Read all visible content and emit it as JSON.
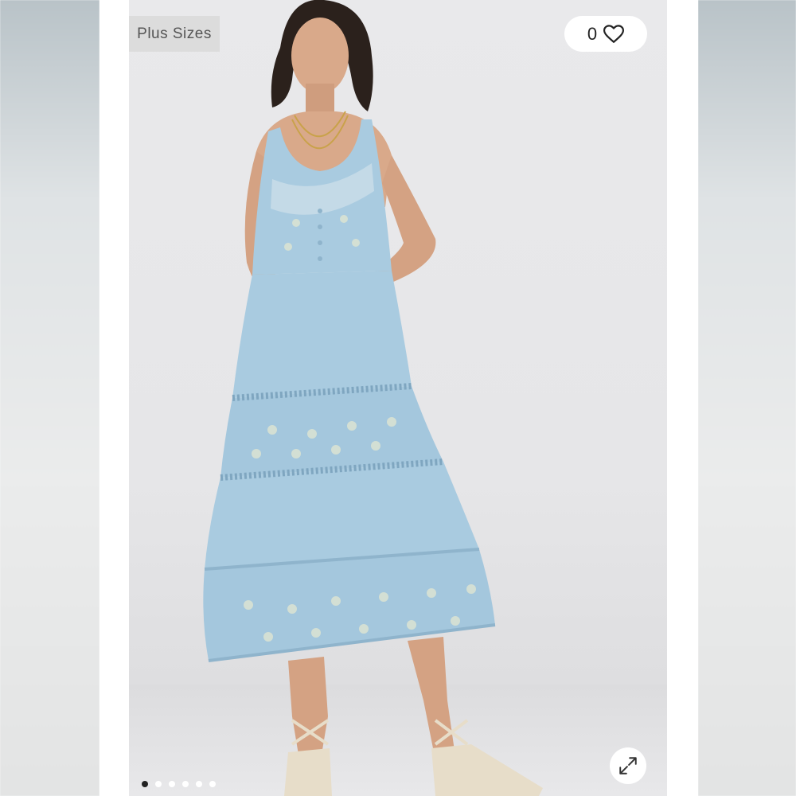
{
  "badge": {
    "label": "Plus Sizes"
  },
  "likes": {
    "count": "0",
    "icon": "heart-outline-icon"
  },
  "expand": {
    "icon": "expand-arrows-icon"
  },
  "carousel": {
    "total": 6,
    "active_index": 0
  },
  "product": {
    "image": "model-in-light-blue-tiered-midi-dress"
  },
  "colors": {
    "dress": "#a9cbe0",
    "dress_shadow": "#8fb4cc",
    "skin": "#d9a98a",
    "hair": "#2b211c",
    "sandal": "#e7ddc9"
  }
}
